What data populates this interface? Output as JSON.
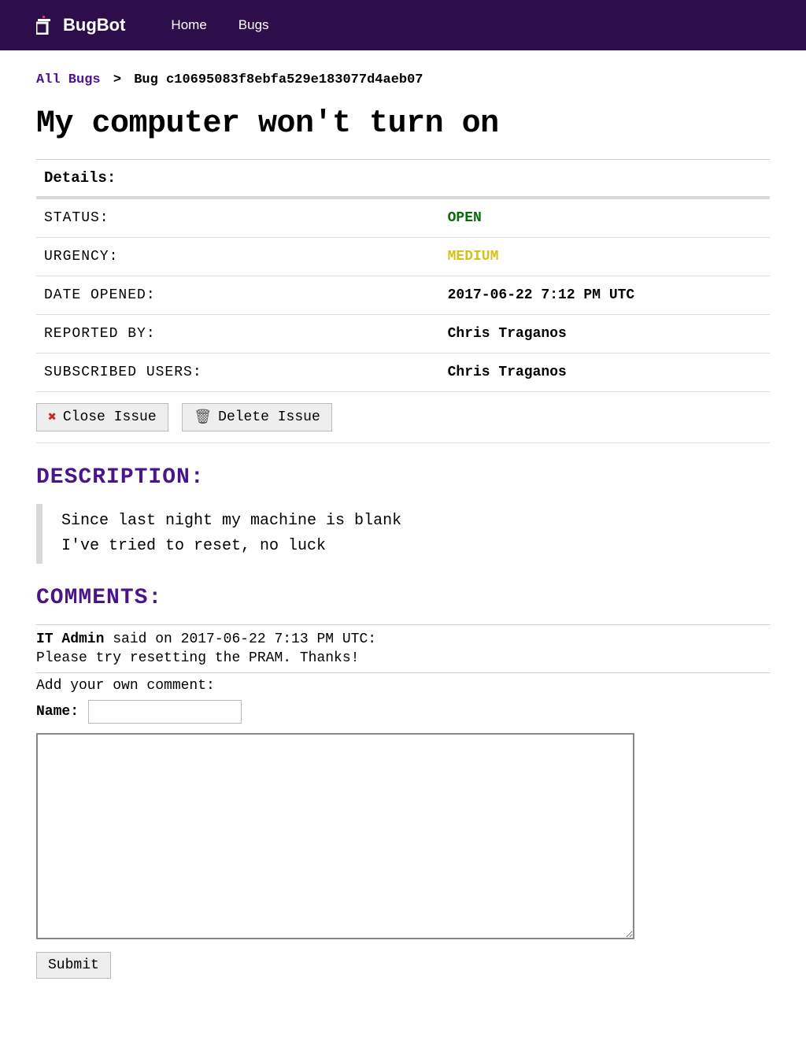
{
  "nav": {
    "brand": "BugBot",
    "home": "Home",
    "bugs": "Bugs"
  },
  "breadcrumb": {
    "all_bugs": "All Bugs",
    "sep": ">",
    "current": "Bug c10695083f8ebfa529e183077d4aeb07"
  },
  "title": "My computer won't turn on",
  "details": {
    "header": "Details:",
    "status_label": "STATUS:",
    "status_value": "OPEN",
    "urgency_label": "URGENCY:",
    "urgency_value": "MEDIUM",
    "date_label": "DATE OPENED:",
    "date_value": "2017-06-22 7:12 PM UTC",
    "reported_label": "REPORTED BY:",
    "reported_value": "Chris Traganos",
    "subscribed_label": "SUBSCRIBED USERS:",
    "subscribed_value": "Chris Traganos"
  },
  "actions": {
    "close": "Close Issue",
    "delete": "Delete Issue"
  },
  "description": {
    "heading": "DESCRIPTION:",
    "line1": "Since last night my machine is blank",
    "line2": "I've tried to reset, no luck"
  },
  "comments": {
    "heading": "COMMENTS:",
    "c0": {
      "author": "IT Admin",
      "meta": " said on 2017-06-22 7:13 PM UTC:",
      "body": "Please try resetting the PRAM. Thanks!"
    },
    "add_label": "Add your own comment:",
    "name_label": "Name:",
    "submit": "Submit"
  }
}
